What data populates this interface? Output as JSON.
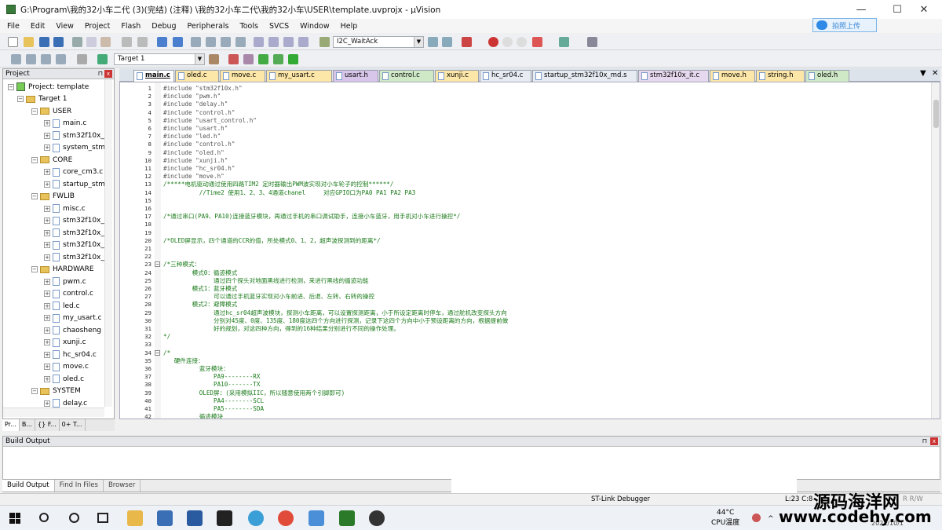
{
  "window": {
    "title": "G:\\Program\\我的32小车二代 (3)(完结) (注释) \\我的32小车二代\\我的32小车\\USER\\template.uvprojx - µVision",
    "minimize": "—",
    "maximize": "☐",
    "close": "✕"
  },
  "menu": [
    "File",
    "Edit",
    "View",
    "Project",
    "Flash",
    "Debug",
    "Peripherals",
    "Tools",
    "SVCS",
    "Window",
    "Help"
  ],
  "cloud_button": "拍照上传",
  "toolbar": {
    "find_combo": "I2C_WaitAck",
    "target_combo": "Target 1"
  },
  "project": {
    "title": "Project",
    "pin": "⊓",
    "close": "x",
    "root": "Project: template",
    "target": "Target 1",
    "groups": [
      {
        "name": "USER",
        "files": [
          "main.c",
          "stm32f10x_",
          "system_stm"
        ]
      },
      {
        "name": "CORE",
        "files": [
          "core_cm3.c",
          "startup_stm"
        ]
      },
      {
        "name": "FWLIB",
        "files": [
          "misc.c",
          "stm32f10x_",
          "stm32f10x_",
          "stm32f10x_",
          "stm32f10x_"
        ]
      },
      {
        "name": "HARDWARE",
        "files": [
          "pwm.c",
          "control.c",
          "led.c",
          "my_usart.c",
          "chaosheng",
          "xunji.c",
          "hc_sr04.c",
          "move.c",
          "oled.c"
        ]
      },
      {
        "name": "SYSTEM",
        "files": [
          "delay.c"
        ]
      }
    ],
    "tabs": [
      "Pr...",
      "B...",
      "{} F...",
      "0+ T..."
    ]
  },
  "editor_tabs": [
    {
      "label": "main.c",
      "color": "#ffffff",
      "active": true
    },
    {
      "label": "oled.c",
      "color": "#fde7a8"
    },
    {
      "label": "move.c",
      "color": "#fde7a8"
    },
    {
      "label": "my_usart.c",
      "color": "#fde7a8"
    },
    {
      "label": "usart.h",
      "color": "#d7c6ea"
    },
    {
      "label": "control.c",
      "color": "#cfe9c7"
    },
    {
      "label": "xunji.c",
      "color": "#fde7a8"
    },
    {
      "label": "hc_sr04.c",
      "color": "#e7ecf3"
    },
    {
      "label": "startup_stm32f10x_md.s",
      "color": "#e7ecf3"
    },
    {
      "label": "stm32f10x_it.c",
      "color": "#e6d8ee"
    },
    {
      "label": "move.h",
      "color": "#fde7a8"
    },
    {
      "label": "string.h",
      "color": "#fde7a8"
    },
    {
      "label": "oled.h",
      "color": "#cfe9c7"
    }
  ],
  "code": [
    {
      "n": "1",
      "t": "#include \"stm32f10x.h\"",
      "pp": true
    },
    {
      "n": "2",
      "t": "#include \"pwm.h\"",
      "pp": true
    },
    {
      "n": "3",
      "t": "#include \"delay.h\"",
      "pp": true
    },
    {
      "n": "4",
      "t": "#include \"control.h\"",
      "pp": true
    },
    {
      "n": "5",
      "t": "#include \"usart_control.h\"",
      "pp": true
    },
    {
      "n": "6",
      "t": "#include \"usart.h\"",
      "pp": true
    },
    {
      "n": "7",
      "t": "#include \"led.h\"",
      "pp": true
    },
    {
      "n": "8",
      "t": "#include \"control.h\"",
      "pp": true
    },
    {
      "n": "9",
      "t": "#include \"oled.h\"",
      "pp": true
    },
    {
      "n": "10",
      "t": "#include \"xunji.h\"",
      "pp": true
    },
    {
      "n": "11",
      "t": "#include \"hc_sr04.h\"",
      "pp": true
    },
    {
      "n": "12",
      "t": "#include \"move.h\"",
      "pp": true
    },
    {
      "n": "13",
      "t": "/*****电机驱动通过使用四路TIM2 定时器输出PWM波实现对小车轮子的控制******/"
    },
    {
      "n": "14",
      "t": "          //Time2 使用1、2、3、4通道chanel     对应GPIO口为PA0 PA1 PA2 PA3"
    },
    {
      "n": "15",
      "t": ""
    },
    {
      "n": "16",
      "t": ""
    },
    {
      "n": "17",
      "t": "/*通过串口(PA9、PA10)连接蓝牙模块，再通过手机的串口调试助手，连接小车蓝牙，用手机对小车进行操控*/"
    },
    {
      "n": "18",
      "t": ""
    },
    {
      "n": "19",
      "t": ""
    },
    {
      "n": "20",
      "t": "/*OLED屏显示，四个通道的CCR的值，所处模式0、1、2，超声波探测到的距离*/"
    },
    {
      "n": "21",
      "t": ""
    },
    {
      "n": "22",
      "t": ""
    },
    {
      "n": "23",
      "t": "/*三种模式：",
      "fold": true
    },
    {
      "n": "24",
      "t": "        模式0：循迹模式"
    },
    {
      "n": "25",
      "t": "              通过四个探头对地面黑线进行检测，来进行黑线的循迹功能"
    },
    {
      "n": "26",
      "t": "        模式1：蓝牙模式"
    },
    {
      "n": "27",
      "t": "              可以通过手机蓝牙实现对小车前进、后退、左转、右转的操控"
    },
    {
      "n": "28",
      "t": "        模式2：避障模式"
    },
    {
      "n": "29",
      "t": "              通过hc_sr04超声波模块，探测小车距离，可以设置探测距离，小于所设定距离时停车，通过舵机改变探头方向"
    },
    {
      "n": "30",
      "t": "              分别对45度、0度、135度、180度这四个方向进行探测，记录下这四个方向中小于预设距离的方向，根据提前做"
    },
    {
      "n": "31",
      "t": "              好的规划，对这四种方向，得到的16种结果分别进行不同的操作处理。"
    },
    {
      "n": "32",
      "t": "*/"
    },
    {
      "n": "33",
      "t": ""
    },
    {
      "n": "34",
      "t": "/*",
      "fold": true
    },
    {
      "n": "35",
      "t": "   硬件连接："
    },
    {
      "n": "36",
      "t": "          蓝牙模块："
    },
    {
      "n": "37",
      "t": "              PA9--------RX"
    },
    {
      "n": "38",
      "t": "              PA10-------TX"
    },
    {
      "n": "39",
      "t": "          OLED屏：(采用模拟IIC，所以随意使用两个引脚即可)"
    },
    {
      "n": "40",
      "t": "              PA4--------SCL"
    },
    {
      "n": "41",
      "t": "              PA5--------SDA"
    },
    {
      "n": "42",
      "t": "          循迹模块"
    }
  ],
  "build": {
    "title": "Build Output",
    "tabs": [
      "Build Output",
      "Find In Files",
      "Browser"
    ]
  },
  "status": {
    "debugger": "ST-Link Debugger",
    "position": "L:23 C:8",
    "mode": "R  R/W"
  },
  "taskbar": {
    "temp": "44°C",
    "temp_label": "CPU温度",
    "date": "2021/10/1"
  },
  "watermark": {
    "line1": "源码海洋网",
    "line2": "www.codehy.com"
  }
}
